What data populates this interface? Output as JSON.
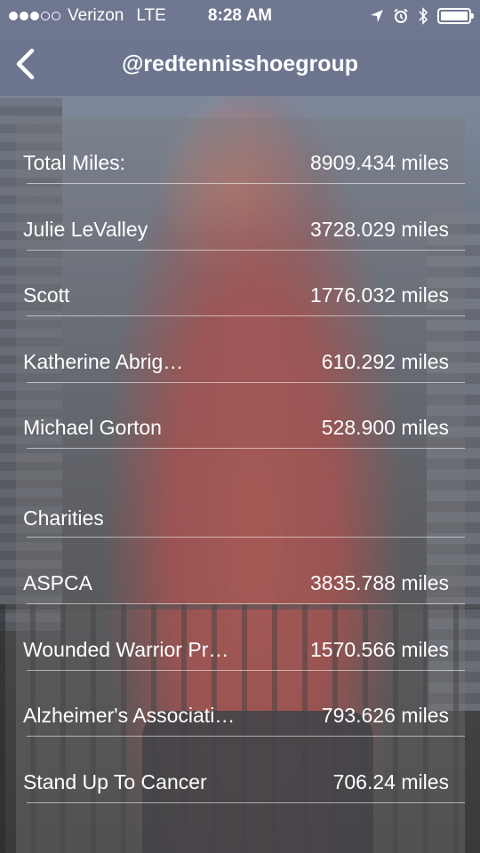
{
  "status_bar": {
    "carrier": "Verizon",
    "network": "LTE",
    "time": "8:28 AM",
    "signal_strength": 3,
    "signal_max": 5,
    "battery_level": 1.0
  },
  "nav": {
    "title": "@redtennisshoegroup",
    "back_icon": "chevron-left-icon"
  },
  "runners": [
    {
      "name": "Total Miles:",
      "miles": "8909.434 miles"
    },
    {
      "name": "Julie LeValley",
      "miles": "3728.029 miles"
    },
    {
      "name": "Scott",
      "miles": "1776.032 miles"
    },
    {
      "name": "Katherine Abrig…",
      "miles": "610.292 miles"
    },
    {
      "name": "Michael Gorton",
      "miles": "528.900 miles"
    }
  ],
  "charities_header": "Charities",
  "charities": [
    {
      "name": "ASPCA",
      "miles": "3835.788 miles"
    },
    {
      "name": "Wounded Warrior Pr…",
      "miles": "1570.566 miles"
    },
    {
      "name": "Alzheimer's Associati…",
      "miles": "793.626 miles"
    },
    {
      "name": "Stand Up To Cancer",
      "miles": "706.24 miles"
    }
  ]
}
